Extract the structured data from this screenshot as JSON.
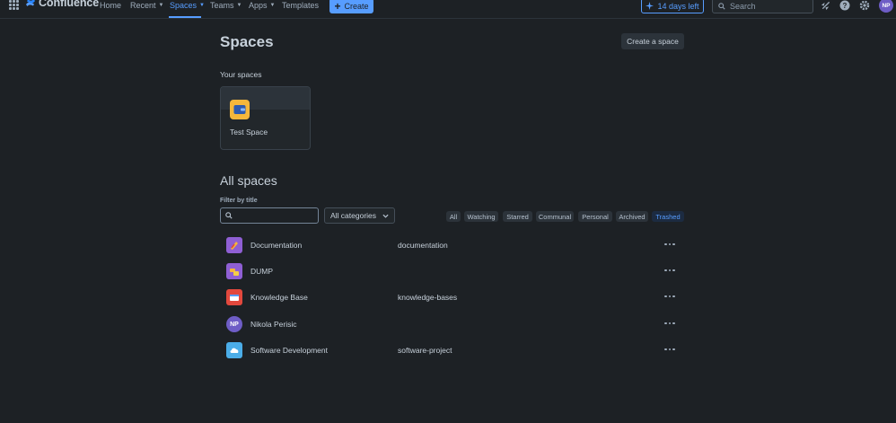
{
  "app": {
    "name": "Confluence"
  },
  "nav": {
    "home": "Home",
    "recent": "Recent",
    "spaces": "Spaces",
    "teams": "Teams",
    "apps": "Apps",
    "templates": "Templates",
    "create": "Create",
    "trial": "14 days left",
    "search_placeholder": "Search",
    "avatar_initials": "NP"
  },
  "page": {
    "title": "Spaces",
    "create_space": "Create a space",
    "your_spaces_label": "Your spaces",
    "your_spaces": [
      {
        "name": "Test Space",
        "icon": "wallet-icon",
        "icon_color": "#f5b73b"
      }
    ],
    "all_spaces_title": "All spaces",
    "filter_label": "Filter by title",
    "filter_value": "",
    "category_select": "All categories",
    "filter_pills": [
      "All",
      "Watching",
      "Starred",
      "Communal",
      "Personal",
      "Archived",
      "Trashed"
    ],
    "selected_pill": "Trashed",
    "spaces": [
      {
        "name": "Documentation",
        "key": "documentation",
        "icon": "rocket-icon",
        "icon_color": "#8f5fd4"
      },
      {
        "name": "DUMP",
        "key": "",
        "icon": "folder-icon",
        "icon_color": "#8f5fd4"
      },
      {
        "name": "Knowledge Base",
        "key": "knowledge-bases",
        "icon": "book-icon",
        "icon_color": "#e2483d"
      },
      {
        "name": "Nikola Perisic",
        "key": "",
        "icon": "avatar",
        "avatar_initials": "NP",
        "icon_color": "#6e5dc6"
      },
      {
        "name": "Software Development",
        "key": "software-project",
        "icon": "cloud-icon",
        "icon_color": "#4bade8"
      }
    ]
  }
}
